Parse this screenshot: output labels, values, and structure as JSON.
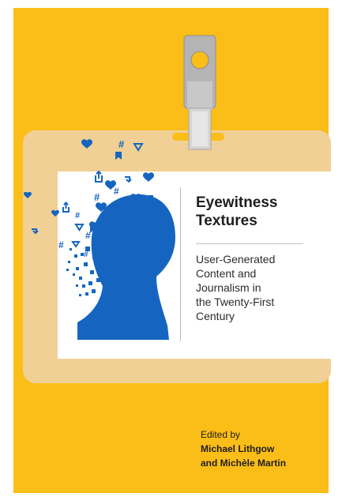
{
  "cover": {
    "background_color": "#fbbd17",
    "badge_color": "#f0d095",
    "accent_blue": "#1565c0"
  },
  "book": {
    "title": "Eyewitness\nTextures",
    "subtitle": "User-Generated\nContent and\nJournalism in\nthe Twenty-First\nCentury",
    "edited_by": "Edited by",
    "editor_line_1": "Michael Lithgow",
    "editor_line_2": "and Michèle Martin"
  },
  "art": {
    "illustration": "head-silhouette-dissolving-into-social-icons",
    "icons": [
      "heart-icon",
      "hashtag-icon",
      "retweet-icon",
      "share-icon",
      "bookmark-icon",
      "location-icon"
    ]
  }
}
